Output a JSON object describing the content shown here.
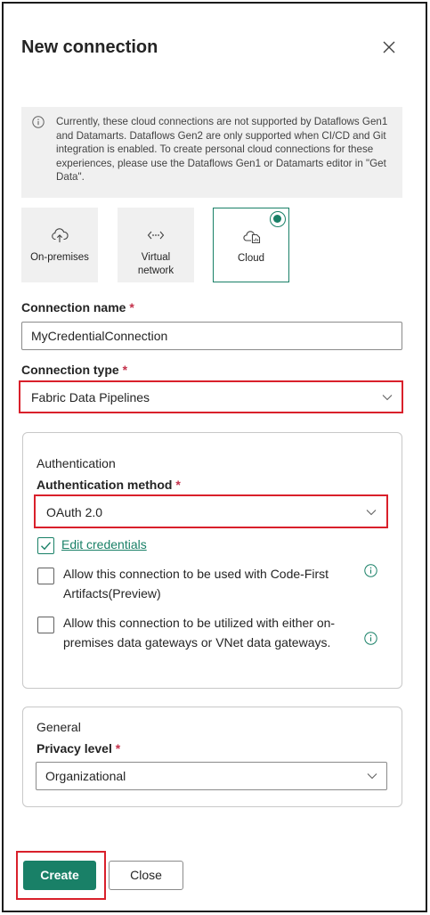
{
  "dialog": {
    "title": "New connection"
  },
  "info_message": "Currently, these cloud connections are not supported by Dataflows Gen1 and Datamarts. Dataflows Gen2 are only supported when CI/CD and Git integration is enabled. To create personal cloud connections for these experiences, please use the Dataflows Gen1 or Datamarts editor in \"Get Data\".",
  "connection_tiles": [
    {
      "label": "On-premises",
      "icon": "cloud-upload-icon",
      "selected": false
    },
    {
      "label": "Virtual network",
      "icon": "network-code-icon",
      "selected": false
    },
    {
      "label": "Cloud",
      "icon": "cloud-document-icon",
      "selected": true
    }
  ],
  "connection_name": {
    "label": "Connection name",
    "required_mark": "*",
    "value": "MyCredentialConnection"
  },
  "connection_type": {
    "label": "Connection type",
    "required_mark": "*",
    "value": "Fabric Data Pipelines"
  },
  "authentication": {
    "section_title": "Authentication",
    "method_label": "Authentication method",
    "required_mark": "*",
    "method_value": "OAuth 2.0",
    "edit_credentials": {
      "label": "Edit credentials",
      "checked": true
    },
    "code_first": {
      "label": "Allow this connection to be used with Code-First Artifacts(Preview)",
      "checked": false
    },
    "gateways": {
      "label": "Allow this connection to be utilized with either on-premises data gateways or VNet data gateways.",
      "checked": false
    }
  },
  "general": {
    "section_title": "General",
    "privacy_label": "Privacy level",
    "required_mark": "*",
    "privacy_value": "Organizational"
  },
  "buttons": {
    "create": "Create",
    "close": "Close"
  },
  "colors": {
    "accent": "#198067",
    "required": "#c4314b",
    "highlight": "#d9202b"
  }
}
